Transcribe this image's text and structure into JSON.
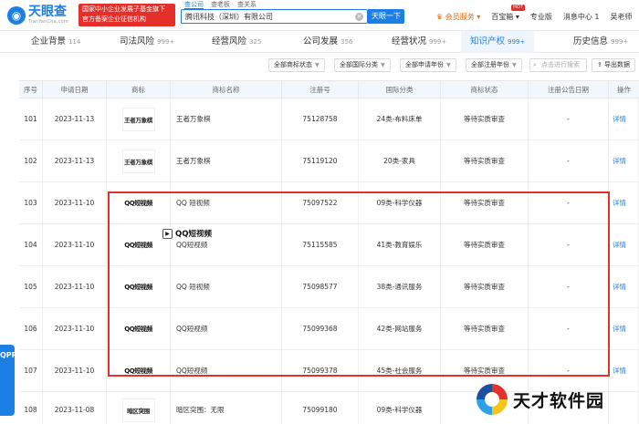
{
  "header": {
    "logo_text": "天眼查",
    "logo_sub": "TianYanCha.com",
    "promo_line1": "国家中小企业发展子基金旗下",
    "promo_line2": "官方备案企业征信机构",
    "search_tabs": [
      "查公司",
      "查老板",
      "查关系"
    ],
    "search_value": "腾讯科技（深圳）有限公司",
    "search_button": "天眼一下",
    "nav": [
      {
        "label": "会员服务",
        "vip": true
      },
      {
        "label": "百宝箱",
        "badge": "HOT"
      },
      {
        "label": "专业版"
      },
      {
        "label": "消息中心 1"
      },
      {
        "label": "吴老师"
      }
    ]
  },
  "tabs": [
    {
      "label": "企业背景",
      "count": "114"
    },
    {
      "label": "司法风险",
      "count": "999+"
    },
    {
      "label": "经营风险",
      "count": "325"
    },
    {
      "label": "公司发展",
      "count": "356"
    },
    {
      "label": "经营状况",
      "count": "999+"
    },
    {
      "label": "知识产权",
      "count": "999+",
      "active": true
    },
    {
      "label": "历史信息",
      "count": "999+"
    }
  ],
  "filters": [
    "全部商标状态",
    "全部国际分类",
    "全部申请年份",
    "全部注册年份"
  ],
  "filter_search_placeholder": "点击进行搜索",
  "export_label": "导出数据",
  "table": {
    "headers": [
      "序号",
      "申请日期",
      "商标",
      "商标名称",
      "注册号",
      "国际分类",
      "商标状态",
      "注册公告日期",
      "操作"
    ],
    "rows": [
      {
        "no": "101",
        "date": "2023-11-13",
        "logo": "王者万象棋",
        "name": "王者万象棋",
        "reg": "75128758",
        "cls": "24类-布料床单",
        "status": "等待实质审查",
        "pub": "-",
        "op": "详情"
      },
      {
        "no": "102",
        "date": "2023-11-13",
        "logo": "王者万象棋",
        "name": "王者万象棋",
        "reg": "75119120",
        "cls": "20类-家具",
        "status": "等待实质审查",
        "pub": "-",
        "op": "详情"
      },
      {
        "no": "103",
        "date": "2023-11-10",
        "logo": "QQ短视频",
        "name": "QQ 短视频",
        "reg": "75097522",
        "cls": "09类-科学仪器",
        "status": "等待实质审查",
        "pub": "-",
        "op": "详情"
      },
      {
        "no": "104",
        "date": "2023-11-10",
        "logo": "QQ短视频",
        "name": "QQ短视频",
        "reg": "75115585",
        "cls": "41类-教育娱乐",
        "status": "等待实质审查",
        "pub": "-",
        "op": "详情"
      },
      {
        "no": "105",
        "date": "2023-11-10",
        "logo": "QQ短视频",
        "name": "QQ 短视频",
        "reg": "75098577",
        "cls": "38类-通讯服务",
        "status": "等待实质审查",
        "pub": "-",
        "op": "详情"
      },
      {
        "no": "106",
        "date": "2023-11-10",
        "logo": "QQ短视频",
        "name": "QQ短视频",
        "reg": "75099368",
        "cls": "42类-网站服务",
        "status": "等待实质审查",
        "pub": "-",
        "op": "详情"
      },
      {
        "no": "107",
        "date": "2023-11-10",
        "logo": "QQ短视频",
        "name": "QQ短视频",
        "reg": "75099378",
        "cls": "45类-社会服务",
        "status": "等待实质审查",
        "pub": "-",
        "op": "详情"
      },
      {
        "no": "108",
        "date": "2023-11-08",
        "logo": "暗区突围",
        "name": "暗区突围：无限",
        "reg": "75099180",
        "cls": "09类-科学仪器",
        "status": "",
        "pub": "",
        "op": ""
      }
    ]
  },
  "popup_label": "QQ短视频",
  "float_left": "QPP",
  "watermark": "天才软件园",
  "colors": {
    "accent": "#1c7fe6",
    "highlight": "#e52f2a",
    "header_bg": "#f2f7fc"
  }
}
